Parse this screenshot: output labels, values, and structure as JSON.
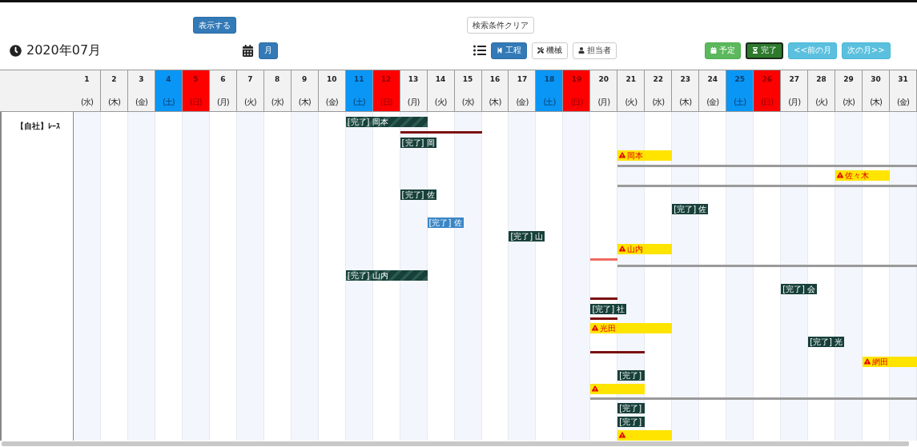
{
  "top_buttons": [
    {
      "label": "表示する",
      "kind": "primary"
    },
    {
      "label": "検索条件クリア",
      "kind": "default"
    }
  ],
  "month": {
    "title": "2020年07月"
  },
  "period_buttons": [
    {
      "label": "月",
      "selected": true
    }
  ],
  "view_buttons": [
    {
      "label": "工程",
      "selected": true
    },
    {
      "label": "機械",
      "selected": false
    },
    {
      "label": "担当者",
      "selected": false
    }
  ],
  "status_buttons": [
    {
      "label": "予定",
      "selected": false
    },
    {
      "label": "完了",
      "selected": true
    }
  ],
  "nav_buttons": [
    {
      "label": "<<前の月"
    },
    {
      "label": "次の月>>"
    }
  ],
  "calendar": {
    "days": [
      {
        "day": "1",
        "weekday": "(水)",
        "saturday": false,
        "sunday": false
      },
      {
        "day": "2",
        "weekday": "(木)",
        "saturday": false,
        "sunday": false
      },
      {
        "day": "3",
        "weekday": "(金)",
        "saturday": false,
        "sunday": false
      },
      {
        "day": "4",
        "weekday": "(土)",
        "saturday": true,
        "sunday": false
      },
      {
        "day": "5",
        "weekday": "(日)",
        "saturday": false,
        "sunday": true
      },
      {
        "day": "6",
        "weekday": "(月)",
        "saturday": false,
        "sunday": false
      },
      {
        "day": "7",
        "weekday": "(火)",
        "saturday": false,
        "sunday": false
      },
      {
        "day": "8",
        "weekday": "(水)",
        "saturday": false,
        "sunday": false
      },
      {
        "day": "9",
        "weekday": "(木)",
        "saturday": false,
        "sunday": false
      },
      {
        "day": "10",
        "weekday": "(金)",
        "saturday": false,
        "sunday": false
      },
      {
        "day": "11",
        "weekday": "(土)",
        "saturday": true,
        "sunday": false
      },
      {
        "day": "12",
        "weekday": "(日)",
        "saturday": false,
        "sunday": true
      },
      {
        "day": "13",
        "weekday": "(月)",
        "saturday": false,
        "sunday": false
      },
      {
        "day": "14",
        "weekday": "(火)",
        "saturday": false,
        "sunday": false
      },
      {
        "day": "15",
        "weekday": "(水)",
        "saturday": false,
        "sunday": false
      },
      {
        "day": "16",
        "weekday": "(木)",
        "saturday": false,
        "sunday": false
      },
      {
        "day": "17",
        "weekday": "(金)",
        "saturday": false,
        "sunday": false
      },
      {
        "day": "18",
        "weekday": "(土)",
        "saturday": true,
        "sunday": false
      },
      {
        "day": "19",
        "weekday": "(日)",
        "saturday": false,
        "sunday": true
      },
      {
        "day": "20",
        "weekday": "(月)",
        "saturday": false,
        "sunday": false
      },
      {
        "day": "21",
        "weekday": "(火)",
        "saturday": false,
        "sunday": false
      },
      {
        "day": "22",
        "weekday": "(水)",
        "saturday": false,
        "sunday": false
      },
      {
        "day": "23",
        "weekday": "(木)",
        "saturday": false,
        "sunday": false
      },
      {
        "day": "24",
        "weekday": "(金)",
        "saturday": false,
        "sunday": false
      },
      {
        "day": "25",
        "weekday": "(土)",
        "saturday": true,
        "sunday": false
      },
      {
        "day": "26",
        "weekday": "(日)",
        "saturday": false,
        "sunday": true
      },
      {
        "day": "27",
        "weekday": "(月)",
        "saturday": false,
        "sunday": false
      },
      {
        "day": "28",
        "weekday": "(火)",
        "saturday": false,
        "sunday": false
      },
      {
        "day": "29",
        "weekday": "(水)",
        "saturday": false,
        "sunday": false
      },
      {
        "day": "30",
        "weekday": "(木)",
        "saturday": false,
        "sunday": false
      },
      {
        "day": "31",
        "weekday": "(金)",
        "saturday": false,
        "sunday": false
      }
    ],
    "rows": [
      {
        "label": "【自社】ﾚｰｽ",
        "bars": [
          {
            "kind": "done-striped",
            "label": "[完了] 岡本"
          },
          {
            "kind": "line-dark"
          },
          {
            "kind": "done",
            "label": "[完了] 岡"
          },
          {
            "kind": "warning",
            "label": "岡本"
          },
          {
            "kind": "line-gray"
          },
          {
            "kind": "warning",
            "label": "佐々木"
          },
          {
            "kind": "line-gray"
          },
          {
            "kind": "done",
            "label": "[完了] 佐"
          },
          {
            "kind": "done",
            "label": "[完了] 佐"
          },
          {
            "kind": "done-blue",
            "label": "[完了] 佐"
          },
          {
            "kind": "done",
            "label": "[完了] 山"
          },
          {
            "kind": "warning",
            "label": "山内"
          },
          {
            "kind": "line-light"
          },
          {
            "kind": "line-gray"
          },
          {
            "kind": "done-striped",
            "label": "[完了] 山内"
          },
          {
            "kind": "done",
            "label": "[完了] 会"
          },
          {
            "kind": "line-dark"
          },
          {
            "kind": "done",
            "label": "[完了] 社"
          },
          {
            "kind": "line-dark"
          },
          {
            "kind": "warning",
            "label": "光田"
          },
          {
            "kind": "done",
            "label": "[完了] 光"
          },
          {
            "kind": "line-dark"
          },
          {
            "kind": "warning",
            "label": "網田"
          },
          {
            "kind": "done",
            "label": "[完了]"
          },
          {
            "kind": "warning"
          },
          {
            "kind": "line-gray"
          },
          {
            "kind": "done",
            "label": "[完了]"
          },
          {
            "kind": "done",
            "label": "[完了]"
          },
          {
            "kind": "warning"
          }
        ]
      }
    ]
  }
}
